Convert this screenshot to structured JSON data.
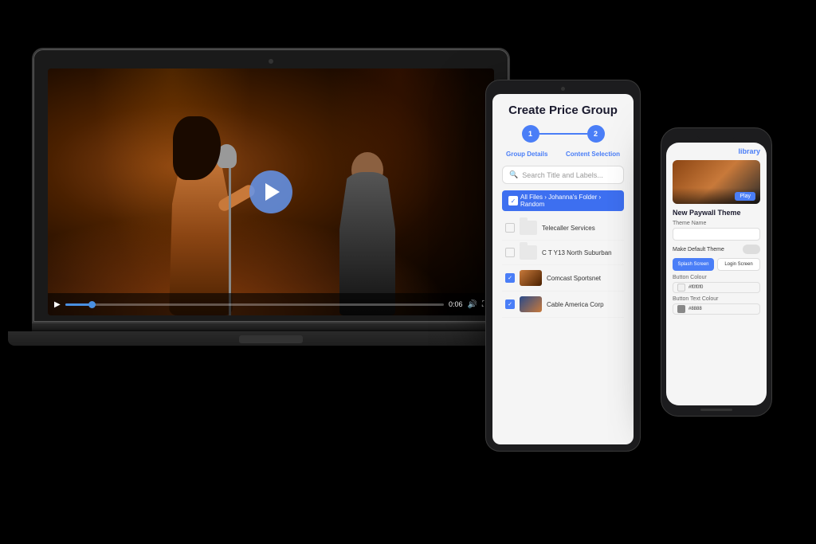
{
  "scene": {
    "background": "#000000"
  },
  "laptop": {
    "video": {
      "play_button_label": "▶",
      "time_current": "0:06",
      "time_total": "0:06",
      "progress_percent": 8
    }
  },
  "tablet": {
    "title": "Create Price Group",
    "stepper": {
      "step1_label": "Group Details",
      "step2_label": "Content Selection",
      "step1_num": "1",
      "step2_num": "2"
    },
    "search": {
      "placeholder": "Search Title and Labels..."
    },
    "breadcrumb": "All Files › Johanna's Folder › Random",
    "files": [
      {
        "name": "Telecaller Services",
        "type": "folder",
        "checked": false
      },
      {
        "name": "C T Y13 North Suburban",
        "type": "folder",
        "checked": false
      },
      {
        "name": "Comcast Sportsnet",
        "type": "video",
        "checked": true
      },
      {
        "name": "Cable America Corp",
        "type": "video",
        "checked": true
      }
    ]
  },
  "phone": {
    "header_link": "library",
    "concert_section": {
      "play_label": "Play"
    },
    "paywall_section": {
      "title": "New Paywall Theme",
      "theme_name_label": "Theme Name",
      "theme_name_value": "",
      "make_default_label": "Make Default Theme",
      "splash_screen_btn": "Splash Screen",
      "login_screen_btn": "Login Screen",
      "button_colour_label": "Button Colour",
      "button_colour_value": "#f0f0f0",
      "button_colour_hex": "#f0f0f0",
      "button_text_colour_label": "Button Text Colour",
      "button_text_colour_value": "#8888",
      "button_text_colour_hex": "#8888"
    }
  }
}
